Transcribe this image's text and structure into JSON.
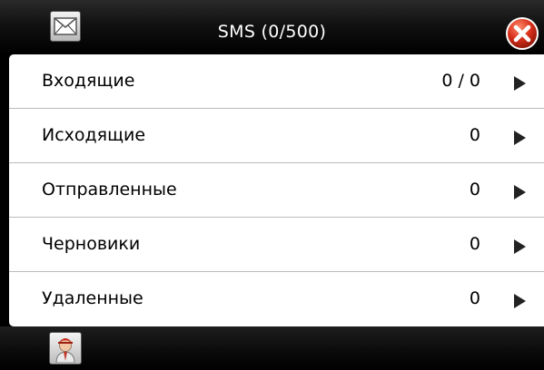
{
  "header": {
    "title": "SMS (0/500)",
    "left_icon": "envelope-icon",
    "right_icon": "close-icon",
    "close_color": "#d8301c"
  },
  "folders": [
    {
      "label": "Входящие",
      "count": "0 / 0",
      "icon": "chevron-right-icon"
    },
    {
      "label": "Исходящие",
      "count": "0",
      "icon": "chevron-right-icon"
    },
    {
      "label": "Отправленные",
      "count": "0",
      "icon": "chevron-right-icon"
    },
    {
      "label": "Черновики",
      "count": "0",
      "icon": "chevron-right-icon"
    },
    {
      "label": "Удаленные",
      "count": "0",
      "icon": "chevron-right-icon"
    }
  ],
  "footer": {
    "contacts_icon": "contact-person-icon"
  }
}
